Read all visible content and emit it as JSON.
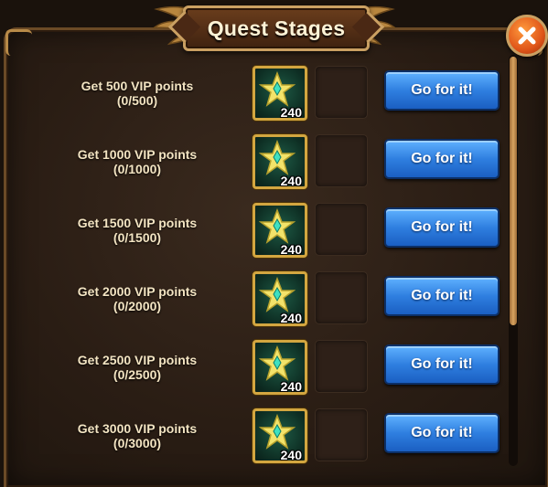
{
  "window": {
    "title": "Quest Stages"
  },
  "colors": {
    "button_blue": "#2f7fe0",
    "frame_gold": "#caa062",
    "close_orange": "#e0561a"
  },
  "reward_icon": "vip-star-crystal-icon",
  "close_icon": "close-x-icon",
  "stages": [
    {
      "label": "Get 500 VIP points",
      "progress": "(0/500)",
      "reward_qty": "240",
      "button": "Go for it!"
    },
    {
      "label": "Get 1000 VIP points",
      "progress": "(0/1000)",
      "reward_qty": "240",
      "button": "Go for it!"
    },
    {
      "label": "Get 1500 VIP points",
      "progress": "(0/1500)",
      "reward_qty": "240",
      "button": "Go for it!"
    },
    {
      "label": "Get 2000 VIP points",
      "progress": "(0/2000)",
      "reward_qty": "240",
      "button": "Go for it!"
    },
    {
      "label": "Get 2500 VIP points",
      "progress": "(0/2500)",
      "reward_qty": "240",
      "button": "Go for it!"
    },
    {
      "label": "Get 3000 VIP points",
      "progress": "(0/3000)",
      "reward_qty": "240",
      "button": "Go for it!"
    }
  ]
}
